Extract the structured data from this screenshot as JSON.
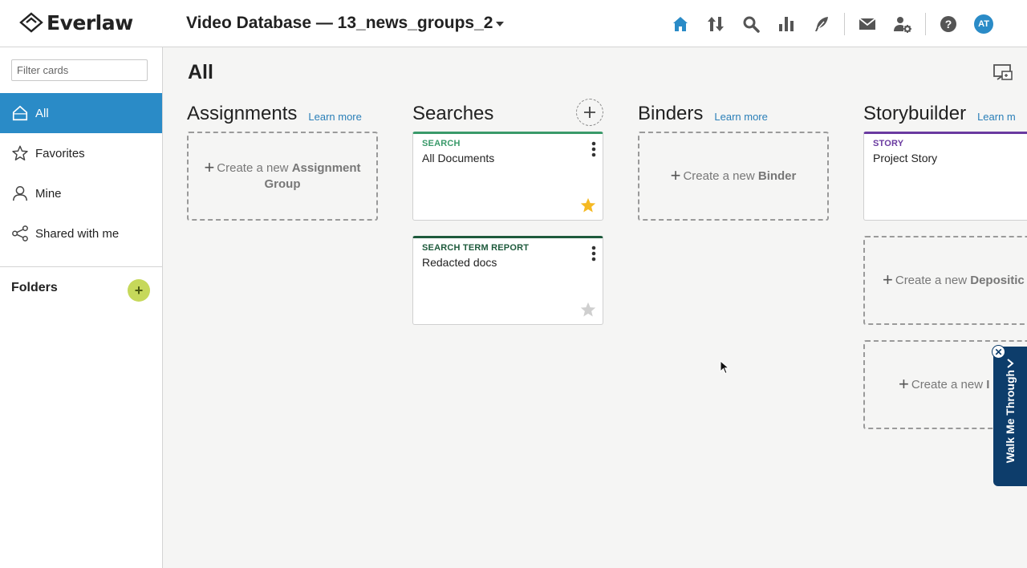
{
  "header": {
    "logo_text": "Everlaw",
    "database_title": "Video Database — 13_news_groups_2",
    "nav_icons": [
      "home-icon",
      "upload-download-icon",
      "search-icon",
      "bar-chart-icon",
      "feather-pen-icon",
      "mail-icon",
      "user-settings-icon",
      "help-icon"
    ],
    "avatar_initials": "AT",
    "accent_color": "#2a8bc7"
  },
  "sidebar": {
    "filter_placeholder": "Filter cards",
    "items": [
      {
        "label": "All",
        "icon": "home-outline-icon",
        "active": true
      },
      {
        "label": "Favorites",
        "icon": "star-outline-icon",
        "active": false
      },
      {
        "label": "Mine",
        "icon": "person-icon",
        "active": false
      },
      {
        "label": "Shared with me",
        "icon": "share-icon",
        "active": false
      }
    ],
    "folders_label": "Folders",
    "folders_add_label": "+"
  },
  "main": {
    "title": "All",
    "columns": [
      {
        "title": "Assignments",
        "learn_more": "Learn more",
        "create_card": {
          "prefix": "Create a new",
          "bold": "Assignment Group"
        }
      },
      {
        "title": "Searches",
        "cards": [
          {
            "type": "SEARCH",
            "name": "All Documents",
            "favorited": true
          },
          {
            "type": "SEARCH TERM REPORT",
            "name": "Redacted docs",
            "favorited": false
          }
        ]
      },
      {
        "title": "Binders",
        "learn_more": "Learn more",
        "create_card": {
          "prefix": "Create a new",
          "bold": "Binder"
        }
      },
      {
        "title": "Storybuilder",
        "learn_more": "Learn m",
        "cards": [
          {
            "type": "STORY",
            "name": "Project Story"
          }
        ],
        "create_cards": [
          {
            "prefix": "Create a new",
            "bold": "Depositic"
          },
          {
            "prefix": "Create a new",
            "bold": "I"
          }
        ]
      }
    ],
    "card_type_colors": {
      "search": "#3a9a6a",
      "search_term_report": "#1e5a3c",
      "story": "#6a3aa0"
    }
  },
  "walkme": {
    "label": "Walk Me Through",
    "close_label": "✕",
    "background": "#0d3d6b"
  }
}
